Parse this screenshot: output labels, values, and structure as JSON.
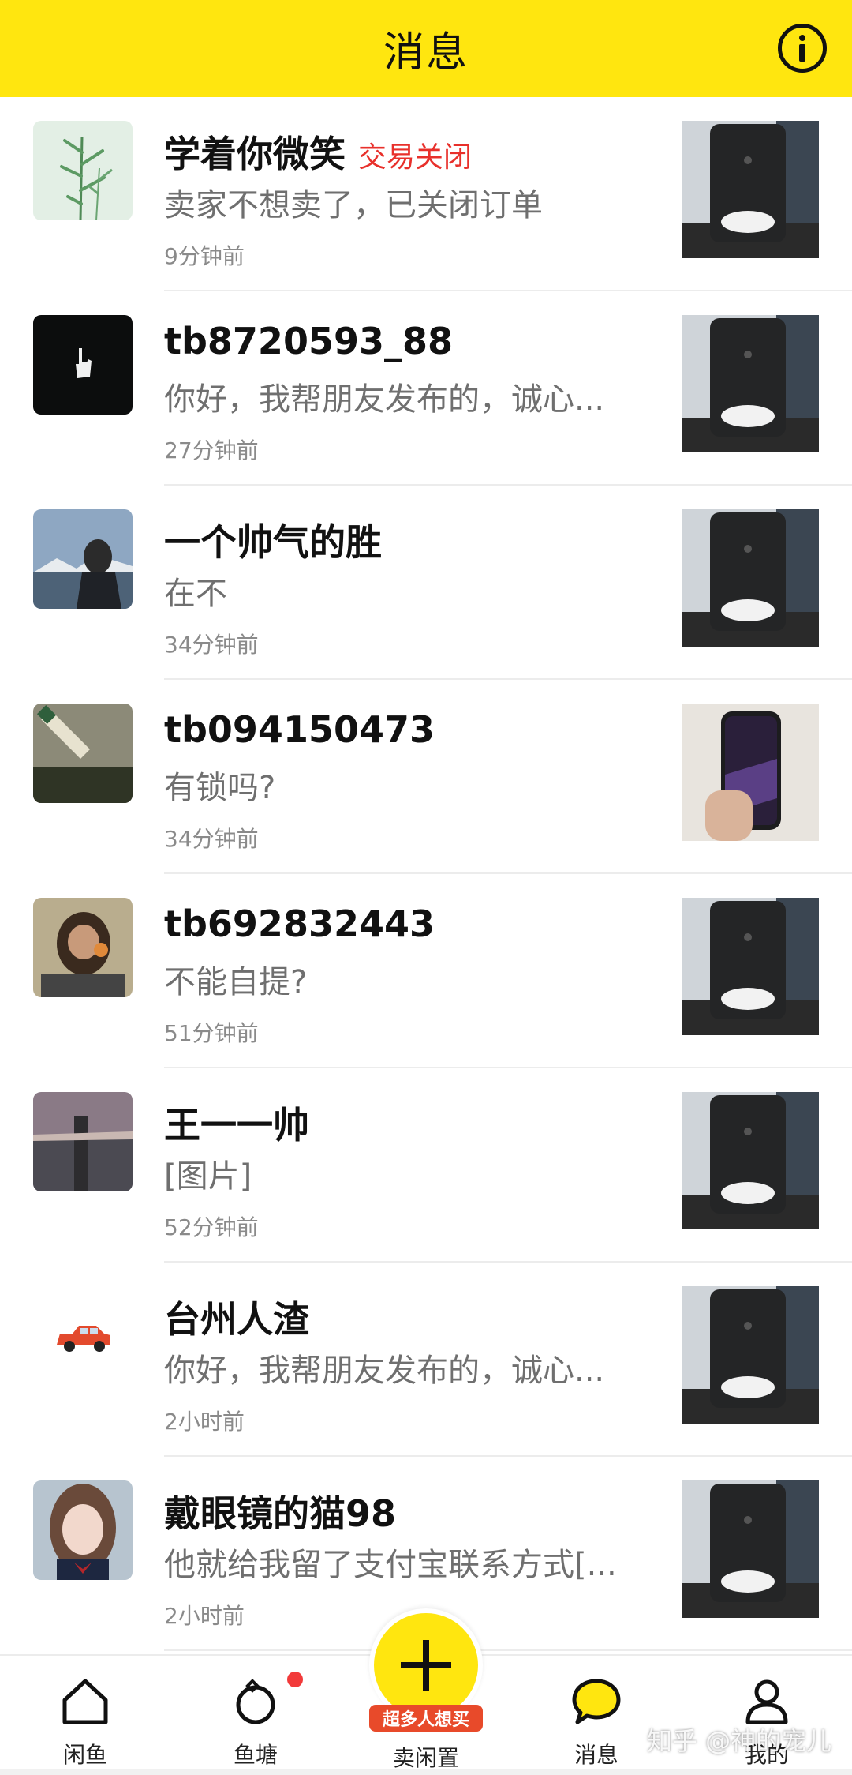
{
  "header": {
    "title": "消息",
    "info_icon": "info-icon"
  },
  "colors": {
    "brand_yellow": "#ffe60f",
    "tag_red": "#e8302b",
    "badge_red": "#e84a2a"
  },
  "conversations": [
    {
      "name": "学着你微笑",
      "tag": "交易关闭",
      "preview": "卖家不想卖了，已关闭订单",
      "time": "9分钟前"
    },
    {
      "name": "tb8720593_88",
      "tag": "",
      "preview": "你好，我帮朋友发布的，诚心...",
      "time": "27分钟前"
    },
    {
      "name": "一个帅气的胜",
      "tag": "",
      "preview": "在不",
      "time": "34分钟前"
    },
    {
      "name": "tb094150473",
      "tag": "",
      "preview": "有锁吗?",
      "time": "34分钟前"
    },
    {
      "name": "tb692832443",
      "tag": "",
      "preview": "不能自提?",
      "time": "51分钟前"
    },
    {
      "name": "王一一帅",
      "tag": "",
      "preview": "[图片]",
      "time": "52分钟前"
    },
    {
      "name": "台州人渣",
      "tag": "",
      "preview": "你好，我帮朋友发布的，诚心...",
      "time": "2小时前"
    },
    {
      "name": "戴眼镜的猫98",
      "tag": "",
      "preview": "他就给我留了支付宝联系方式[...",
      "time": "2小时前"
    }
  ],
  "tabbar": {
    "tabs": [
      {
        "label": "闲鱼",
        "icon": "home-icon"
      },
      {
        "label": "鱼塘",
        "icon": "fishpond-ring-icon"
      },
      {
        "label": "卖闲置",
        "icon": "plus-icon",
        "badge": "超多人想买"
      },
      {
        "label": "消息",
        "icon": "chat-bubble-icon"
      },
      {
        "label": "我的",
        "icon": "person-icon"
      }
    ]
  },
  "watermark": "知乎 @神的宠儿"
}
